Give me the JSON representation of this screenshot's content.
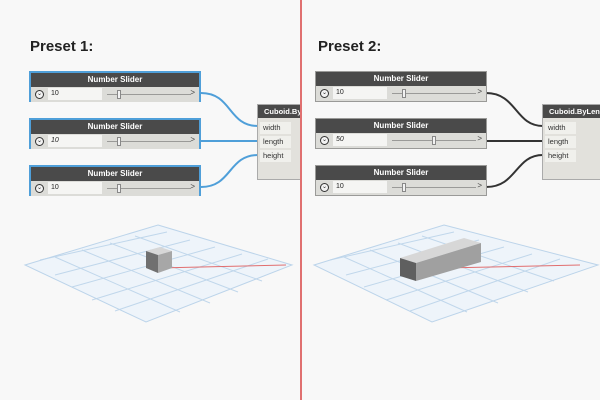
{
  "presets": [
    {
      "title": "Preset 1:",
      "sliders": [
        {
          "header": "Number Slider",
          "value": "10",
          "expand": ">",
          "chevron": "⌄",
          "thumb_fraction": 0.12
        },
        {
          "header": "Number Slider",
          "value": "10",
          "expand": ">",
          "chevron": "⌄",
          "thumb_fraction": 0.12
        },
        {
          "header": "Number Slider",
          "value": "10",
          "expand": ">",
          "chevron": "⌄",
          "thumb_fraction": 0.12
        }
      ],
      "cuboid": {
        "title": "Cuboid.By",
        "ports": [
          "width",
          "length",
          "height"
        ]
      },
      "sliders_selected": true,
      "wire_color": "#4f9fd9"
    },
    {
      "title": "Preset 2:",
      "sliders": [
        {
          "header": "Number Slider",
          "value": "10",
          "expand": ">",
          "chevron": "⌄",
          "thumb_fraction": 0.12
        },
        {
          "header": "Number Slider",
          "value": "50",
          "expand": ">",
          "chevron": "⌄",
          "thumb_fraction": 0.5
        },
        {
          "header": "Number Slider",
          "value": "10",
          "expand": ">",
          "chevron": "⌄",
          "thumb_fraction": 0.12
        }
      ],
      "cuboid": {
        "title": "Cuboid.ByLen",
        "ports": [
          "width",
          "length",
          "height"
        ]
      },
      "sliders_selected": false,
      "wire_color": "#333333"
    }
  ],
  "colors": {
    "divider": "#e07070",
    "grid": "#bcd4ea",
    "grid_accent": "#e06060",
    "box_light": "#cfcfcf",
    "box_dark": "#6d6d6d"
  }
}
